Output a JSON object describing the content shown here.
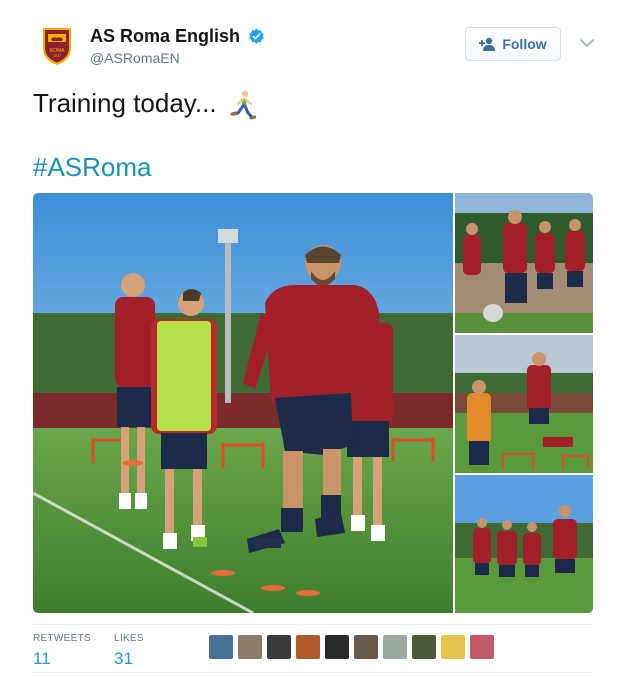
{
  "tweet": {
    "display_name": "AS Roma English",
    "handle": "@ASRomaEN",
    "follow_label": "Follow",
    "text": "Training today...",
    "emoji": "runner-emoji",
    "hashtag": "#ASRoma",
    "verified_color": "#1da1f2",
    "link_color": "#1a8fbd"
  },
  "icons": {
    "avatar": "as-roma-crest-icon",
    "verified": "verified-badge-icon",
    "follow": "add-user-icon",
    "menu": "chevron-down-icon"
  },
  "media": {
    "photo_count": 4,
    "descriptions": [
      "main-training-photo",
      "training-photo-2",
      "training-photo-3",
      "training-photo-4"
    ]
  },
  "stats": {
    "retweets_label": "RETWEETS",
    "retweets_value": "11",
    "likes_label": "LIKES",
    "likes_value": "31"
  },
  "likers": {
    "count": 10,
    "colors": [
      "#4a6f9a",
      "#8a7a6a",
      "#3a3a3a",
      "#b05a2a",
      "#2a2a2a",
      "#6a5a4a",
      "#9aa8a0",
      "#4a5a3a",
      "#e6c34a",
      "#c05a6a"
    ]
  }
}
